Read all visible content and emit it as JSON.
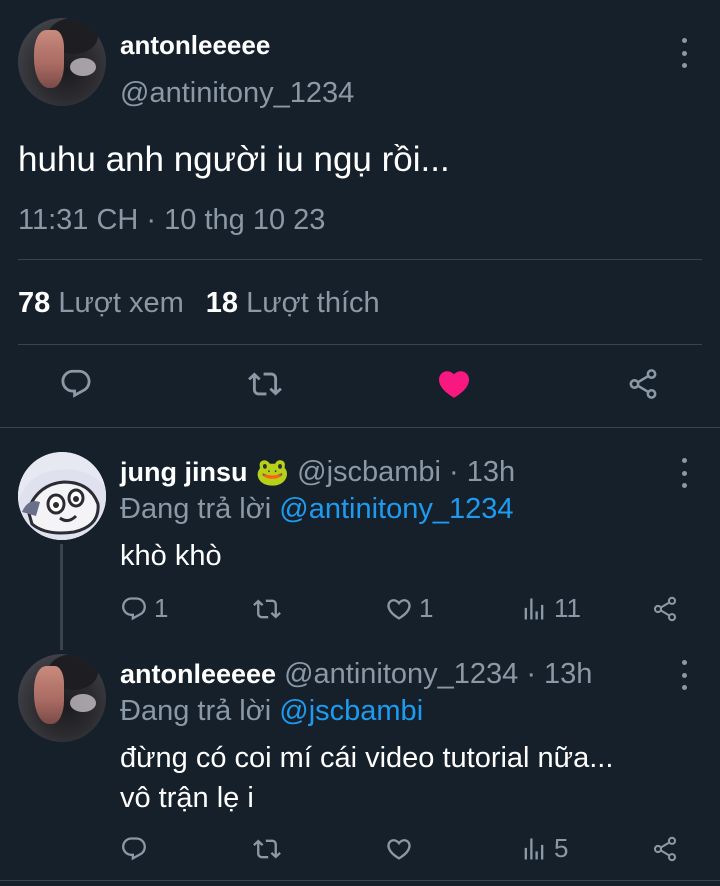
{
  "main_tweet": {
    "name": "antonleeeee",
    "handle": "@antinitony_1234",
    "text": "huhu anh người iu ngụ rồi...",
    "timestamp": "11:31 CH · 10 thg 10 23",
    "views_count": "78",
    "views_label": "Lượt xem",
    "likes_count": "18",
    "likes_label": "Lượt thích",
    "liked": true
  },
  "replies": [
    {
      "name": "jung jinsu",
      "emoji": "🐸",
      "handle": "@jscbambi",
      "time": "· 13h",
      "replying_prefix": "Đang trả lời",
      "replying_to": "@antinitony_1234",
      "text": "khò khò",
      "reply_count": "1",
      "like_count": "1",
      "view_count": "11"
    },
    {
      "name": "antonleeeee",
      "handle": "@antinitony_1234",
      "time": "· 13h",
      "replying_prefix": "Đang trả lời",
      "replying_to": "@jscbambi",
      "text_line1": "đừng có coi mí cái video tutorial nữa...",
      "text_line2": "vô trận lẹ i",
      "view_count": "5"
    }
  ],
  "colors": {
    "background": "#15202b",
    "muted": "#8b98a5",
    "link": "#1d9bf0",
    "like": "#f91880",
    "divider": "#38444d"
  }
}
